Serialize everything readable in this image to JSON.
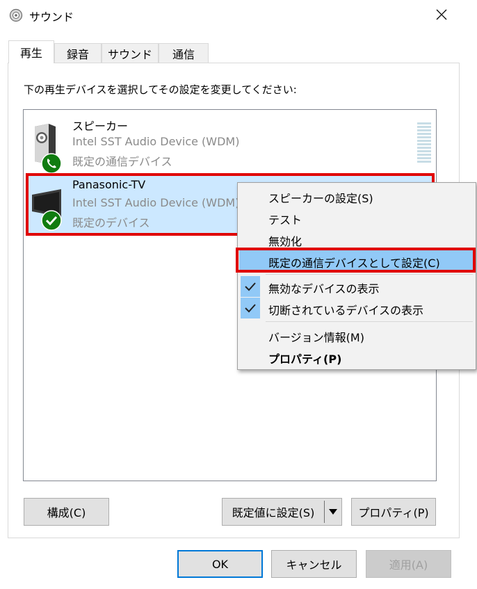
{
  "window": {
    "title": "サウンド"
  },
  "tabs": [
    {
      "label": "再生",
      "active": true
    },
    {
      "label": "録音",
      "active": false
    },
    {
      "label": "サウンド",
      "active": false
    },
    {
      "label": "通信",
      "active": false
    }
  ],
  "instruction": "下の再生デバイスを選択してその設定を変更してください:",
  "devices": [
    {
      "name": "スピーカー",
      "driver": "Intel SST Audio Device (WDM)",
      "status": "既定の通信デバイス",
      "icon": "speaker-icon",
      "badge": "phone-badge-icon",
      "selected": false
    },
    {
      "name": "Panasonic-TV",
      "driver": "Intel SST Audio Device (WDM)",
      "status": "既定のデバイス",
      "icon": "monitor-icon",
      "badge": "checkmark-badge-icon",
      "selected": true
    }
  ],
  "context_menu": {
    "items": [
      {
        "label": "スピーカーの設定(S)"
      },
      {
        "label": "テスト"
      },
      {
        "label": "無効化"
      },
      {
        "label": "既定の通信デバイスとして設定(C)",
        "highlighted": true
      },
      {
        "label": "無効なデバイスの表示",
        "checked": true
      },
      {
        "label": "切断されているデバイスの表示",
        "checked": true
      },
      {
        "label": "バージョン情報(M)"
      },
      {
        "label": "プロパティ(P)",
        "bold": true
      }
    ]
  },
  "buttons": {
    "configure": "構成(C)",
    "set_default": "既定値に設定(S)",
    "properties": "プロパティ(P)",
    "ok": "OK",
    "cancel": "キャンセル",
    "apply": "適用(A)"
  },
  "colors": {
    "selection": "#cce8ff",
    "menu_highlight": "#91c9f7",
    "annotation_red": "#e00000",
    "status_green": "#107c10"
  }
}
